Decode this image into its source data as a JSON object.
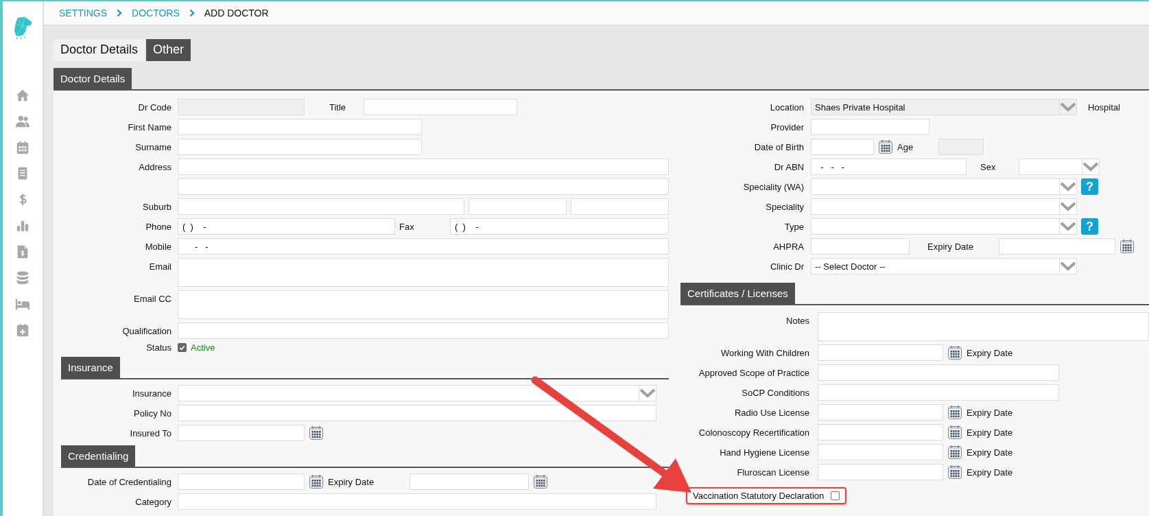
{
  "breadcrumb": [
    {
      "label": "SETTINGS",
      "current": false
    },
    {
      "label": "DOCTORS",
      "current": false
    },
    {
      "label": "ADD DOCTOR",
      "current": true
    }
  ],
  "tabs": [
    {
      "label": "Doctor Details",
      "selected": true
    },
    {
      "label": "Other",
      "selected": false
    }
  ],
  "section_heading": "Doctor Details",
  "doctor": {
    "dr_code": "Dr Code",
    "title": "Title",
    "first_name": "First Name",
    "surname": "Surname",
    "address": "Address",
    "suburb": "Suburb",
    "phone": {
      "label": "Phone",
      "value": "(  )    -"
    },
    "fax": {
      "label": "Fax",
      "value": "(  )    -"
    },
    "mobile": {
      "label": "Mobile",
      "value": "     -   -"
    },
    "email": "Email",
    "email_cc": "Email CC",
    "qualification": "Qualification",
    "status": {
      "label": "Status",
      "checked": true,
      "text": "Active"
    }
  },
  "insurance": {
    "heading": "Insurance",
    "insurance": "Insurance",
    "policy_no": "Policy No",
    "insured_to": "Insured To"
  },
  "credentialing": {
    "heading": "Credentialing",
    "date": "Date of Credentialing",
    "expiry": "Expiry Date",
    "category": "Category"
  },
  "right": {
    "location": {
      "label": "Location",
      "value": "Shaes Private Hospital",
      "suffix": "Hospital"
    },
    "provider": "Provider",
    "dob": "Date of Birth",
    "age": "Age",
    "abn": {
      "label": "Dr ABN",
      "value": "  -   -   -"
    },
    "sex": "Sex",
    "speciality_wa": {
      "label": "Speciality (WA)",
      "help": "?"
    },
    "speciality": "Speciality",
    "type": {
      "label": "Type",
      "help": "?"
    },
    "ahpra": "AHPRA",
    "ahpra_expiry": "Expiry Date",
    "clinic_dr": {
      "label": "Clinic Dr",
      "value": "-- Select Doctor --"
    }
  },
  "certificates": {
    "heading": "Certificates / Licenses",
    "notes": "Notes",
    "rows": [
      {
        "kind": "dated",
        "label": "Working With Children",
        "expiry": "Expiry Date"
      },
      {
        "kind": "text",
        "label": "Approved Scope of Practice"
      },
      {
        "kind": "text",
        "label": "SoCP Conditions"
      },
      {
        "kind": "dated",
        "label": "Radio Use License",
        "expiry": "Expiry Date"
      },
      {
        "kind": "dated",
        "label": "Colonoscopy Recertification",
        "expiry": "Expiry Date"
      },
      {
        "kind": "dated",
        "label": "Hand Hygiene License",
        "expiry": "Expiry Date"
      },
      {
        "kind": "dated",
        "label": "Fluroscan License",
        "expiry": "Expiry Date"
      }
    ],
    "vaccination": {
      "label": "Vaccination Statutory Declaration",
      "checked": false,
      "highlighted": true
    }
  }
}
